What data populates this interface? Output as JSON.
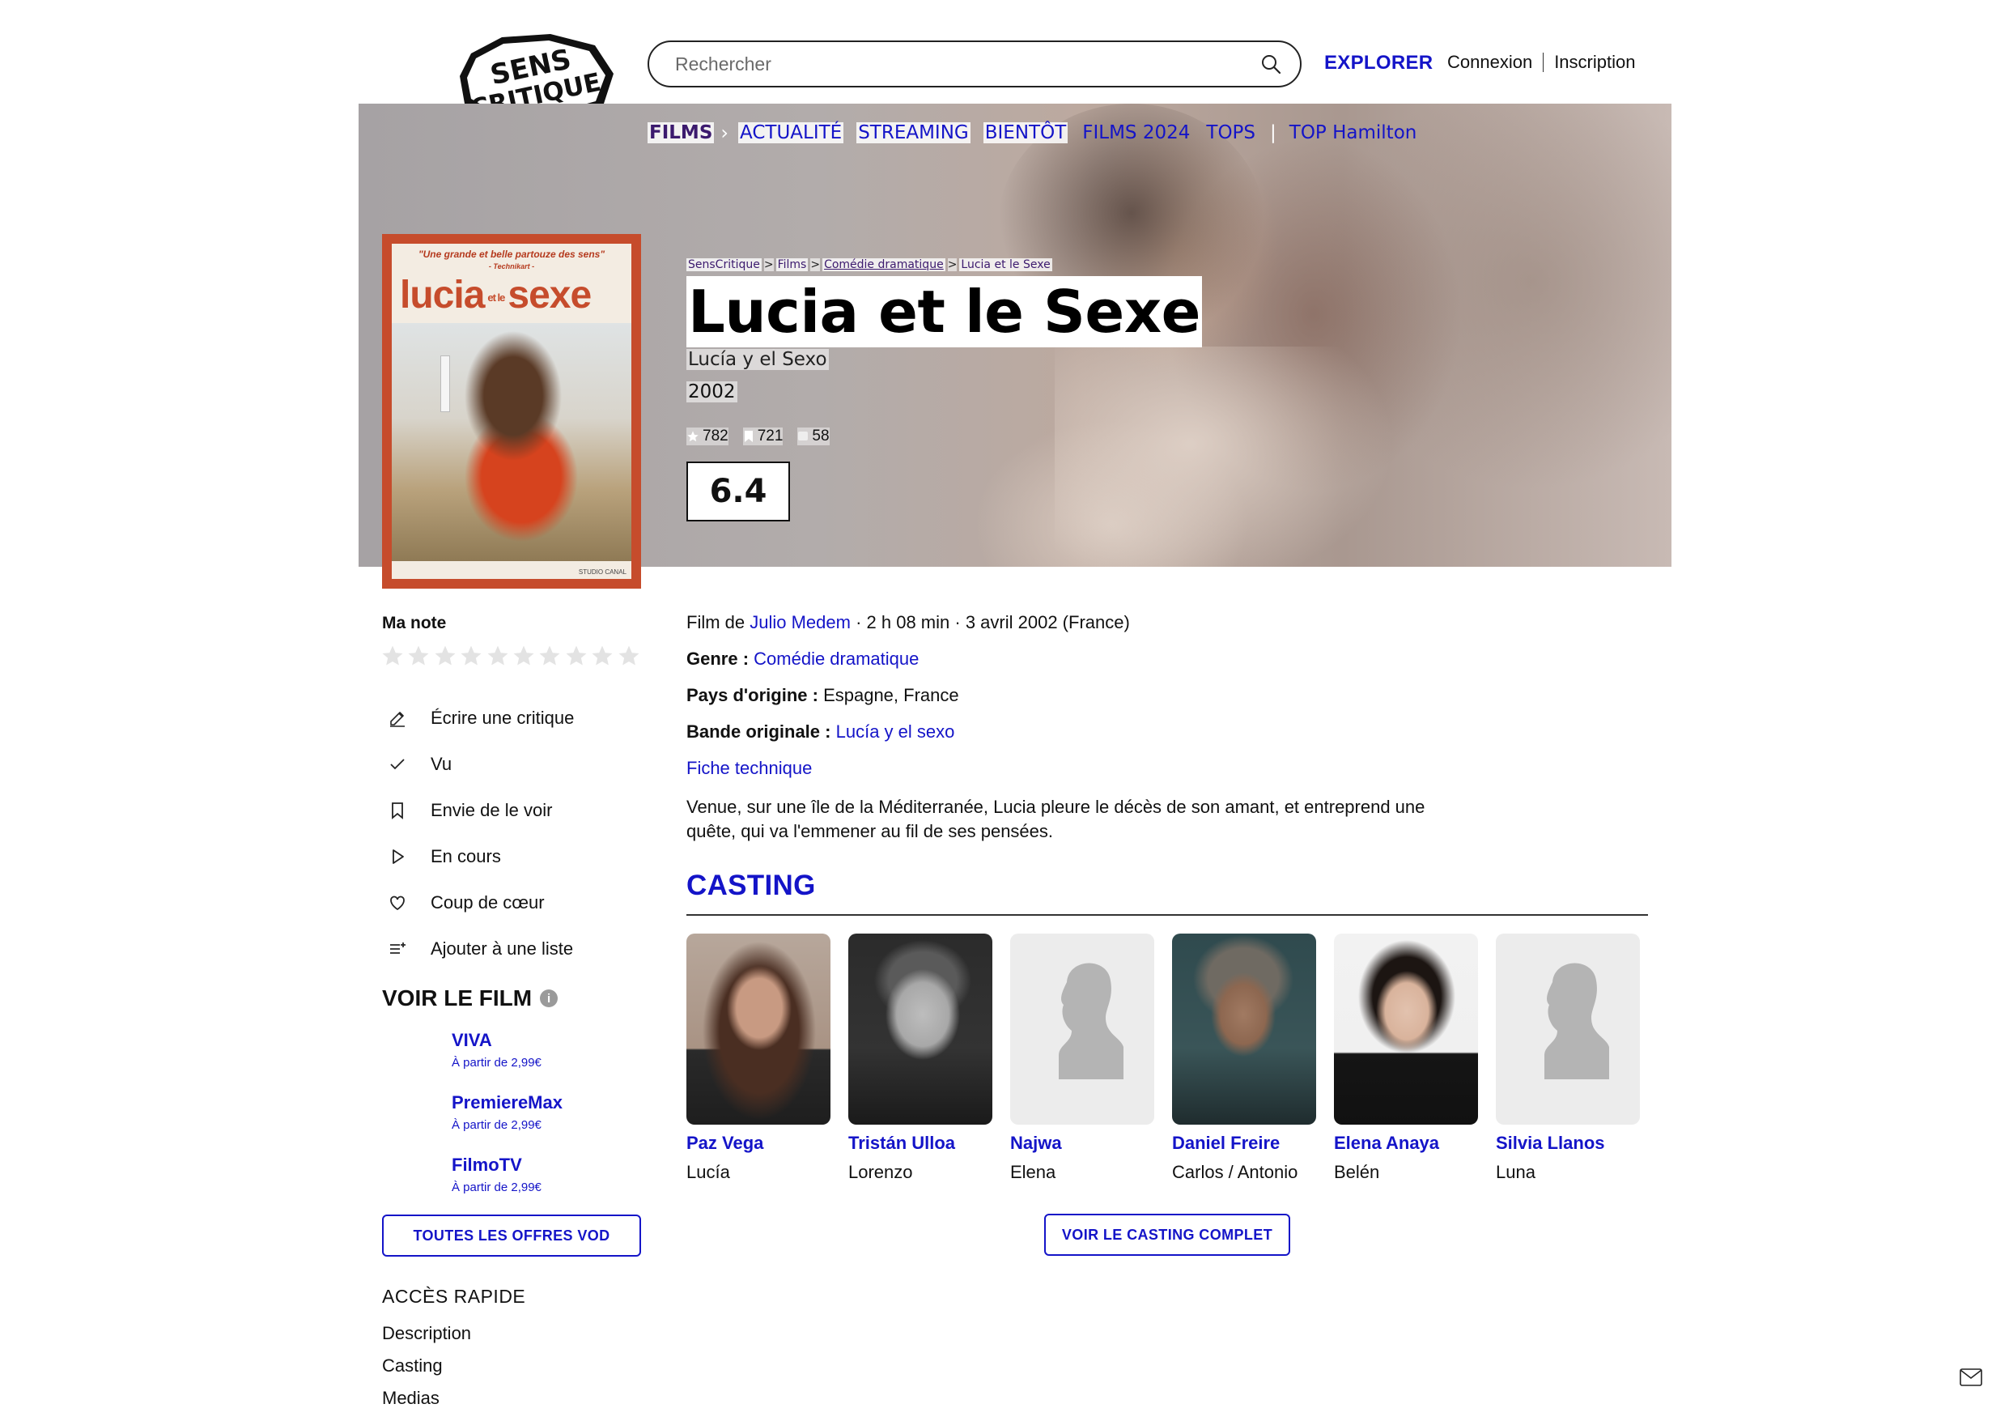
{
  "header": {
    "logo_alt": "SensCritique",
    "search_placeholder": "Rechercher",
    "explorer": "EXPLORER",
    "login": "Connexion",
    "signup": "Inscription"
  },
  "nav": {
    "section": "FILMS",
    "items": [
      "ACTUALITÉ",
      "STREAMING",
      "BIENTÔT",
      "FILMS 2024",
      "TOPS",
      "TOP Hamilton"
    ]
  },
  "breadcrumb": [
    "SensCritique",
    "Films",
    "Comédie dramatique",
    "Lucia et le Sexe"
  ],
  "movie": {
    "title": "Lucia et le Sexe",
    "original_title": "Lucía y el Sexo",
    "year": "2002",
    "ratings_count": "782",
    "wishes_count": "721",
    "reviews_count": "58",
    "score": "6.4",
    "poster": {
      "quote": "\"Une grande et belle partouze des sens\"",
      "quote_source": "- Technikart -",
      "title_left": "lucia",
      "title_mid": "et le",
      "title_right": "sexe",
      "studio": "STUDIO CANAL"
    },
    "director_label": "Film de",
    "director": "Julio Medem",
    "duration": "2 h 08 min",
    "release": "3 avril 2002 (France)",
    "genre_label": "Genre :",
    "genre": "Comédie dramatique",
    "country_label": "Pays d'origine :",
    "country": "Espagne, France",
    "soundtrack_label": "Bande originale :",
    "soundtrack": "Lucía y el sexo",
    "tech_sheet": "Fiche technique",
    "synopsis": "Venue, sur une île de la Méditerranée, Lucia pleure le décès de son amant, et entreprend une quête, qui va l'emmener au fil de ses pensées."
  },
  "sidebar": {
    "my_rating": "Ma note",
    "stars": 10,
    "actions": [
      {
        "label": "Écrire une critique",
        "icon": "pencil-icon"
      },
      {
        "label": "Vu",
        "icon": "check-icon"
      },
      {
        "label": "Envie de le voir",
        "icon": "bookmark-icon"
      },
      {
        "label": "En cours",
        "icon": "play-icon"
      },
      {
        "label": "Coup de cœur",
        "icon": "heart-icon"
      },
      {
        "label": "Ajouter à une liste",
        "icon": "list-add-icon"
      }
    ],
    "watch_title": "VOIR LE FILM",
    "offers": [
      {
        "name": "VIVA",
        "price": "À partir de 2,99€"
      },
      {
        "name": "PremiereMax",
        "price": "À partir de 2,99€"
      },
      {
        "name": "FilmoTV",
        "price": "À partir de 2,99€"
      }
    ],
    "all_offers": "TOUTES LES OFFRES VOD",
    "quick_access": "ACCÈS RAPIDE",
    "quick_links": [
      "Description",
      "Casting",
      "Medias"
    ]
  },
  "casting": {
    "title": "CASTING",
    "actors": [
      {
        "name": "Paz Vega",
        "role": "Lucía",
        "photo": "photo"
      },
      {
        "name": "Tristán Ulloa",
        "role": "Lorenzo",
        "photo": "photo"
      },
      {
        "name": "Najwa",
        "role": "Elena",
        "photo": "placeholder"
      },
      {
        "name": "Daniel Freire",
        "role": "Carlos / Antonio",
        "photo": "photo"
      },
      {
        "name": "Elena Anaya",
        "role": "Belén",
        "photo": "photo"
      },
      {
        "name": "Silvia Llanos",
        "role": "Luna",
        "photo": "placeholder"
      }
    ],
    "full_cast": "VOIR LE CASTING COMPLET"
  },
  "colors": {
    "link": "#1414c8",
    "nav_active": "#3c1a6e",
    "poster_red": "#c64c2c"
  }
}
